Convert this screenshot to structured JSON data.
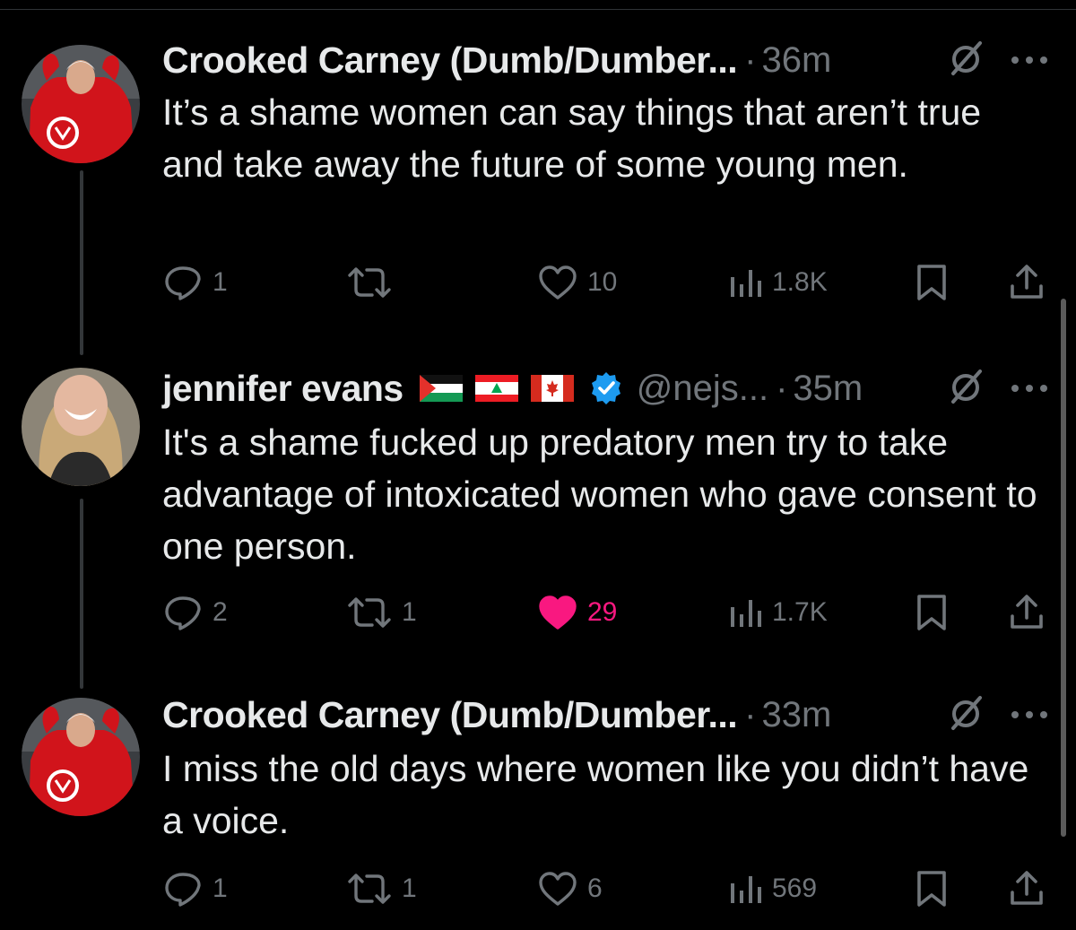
{
  "colors": {
    "background": "#000000",
    "text_primary": "#e7e9ea",
    "text_secondary": "#71767b",
    "liked": "#f91880",
    "verified": "#1d9bf0"
  },
  "tweets": [
    {
      "display_name": "Crooked Carney (Dumb/Dumber...",
      "handle": "",
      "separator": "·",
      "time": "36m",
      "text": "It’s a shame women can say things that aren’t true and take away the future of some young men.",
      "replies": "1",
      "reposts": "",
      "likes": "10",
      "liked": false,
      "views": "1.8K"
    },
    {
      "display_name": "jennifer evans",
      "flags": [
        "palestine-flag",
        "lebanon-flag",
        "canada-flag"
      ],
      "verified": true,
      "handle": "@nejs...",
      "separator": "·",
      "time": "35m",
      "text": "It's a shame fucked up predatory men try to take advantage of intoxicated women who gave consent to one person.",
      "replies": "2",
      "reposts": "1",
      "likes": "29",
      "liked": true,
      "views": "1.7K"
    },
    {
      "display_name": "Crooked Carney (Dumb/Dumber...",
      "handle": "",
      "separator": "·",
      "time": "33m",
      "text": "I miss the old days where women like you didn’t have a voice.",
      "replies": "1",
      "reposts": "1",
      "likes": "6",
      "liked": false,
      "views": "569"
    }
  ],
  "icons": {
    "reply": "reply-icon",
    "repost": "repost-icon",
    "like": "heart-icon",
    "views": "views-icon",
    "bookmark": "bookmark-icon",
    "share": "share-icon",
    "grok": "grok-icon",
    "more": "more-icon"
  }
}
